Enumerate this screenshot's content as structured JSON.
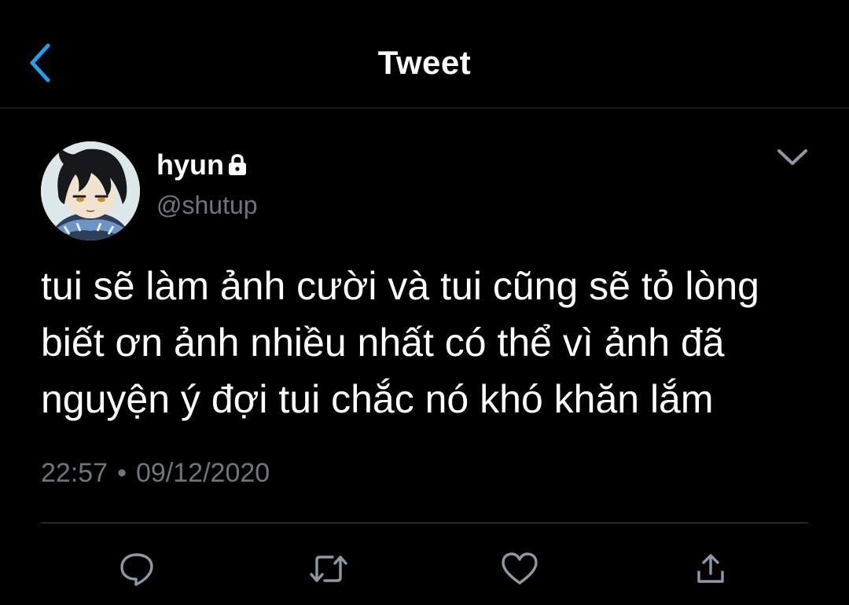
{
  "header": {
    "title": "Tweet",
    "back_icon": "chevron-left-icon",
    "accent_color": "#1da1f2"
  },
  "tweet": {
    "author": {
      "display_name": "hyun",
      "handle": "@shutup",
      "protected_icon": "lock-icon"
    },
    "text": "tui sẽ làm ảnh cười và tui cũng sẽ tỏ lòng\nbiết ơn ảnh nhiều nhất có thể vì ảnh đã\nnguyện ý đợi tui chắc nó khó khăn lắm",
    "time": "22:57",
    "separator": "•",
    "date": "09/12/2020",
    "more_icon": "chevron-down-icon"
  },
  "actions": [
    {
      "name": "reply",
      "icon": "reply-icon"
    },
    {
      "name": "retweet",
      "icon": "retweet-icon"
    },
    {
      "name": "like",
      "icon": "heart-icon"
    },
    {
      "name": "share",
      "icon": "share-icon"
    }
  ],
  "colors": {
    "background": "#000000",
    "text_primary": "#ffffff",
    "text_secondary": "#6e767d",
    "divider": "#3d4449",
    "icon": "#8b98a5"
  }
}
